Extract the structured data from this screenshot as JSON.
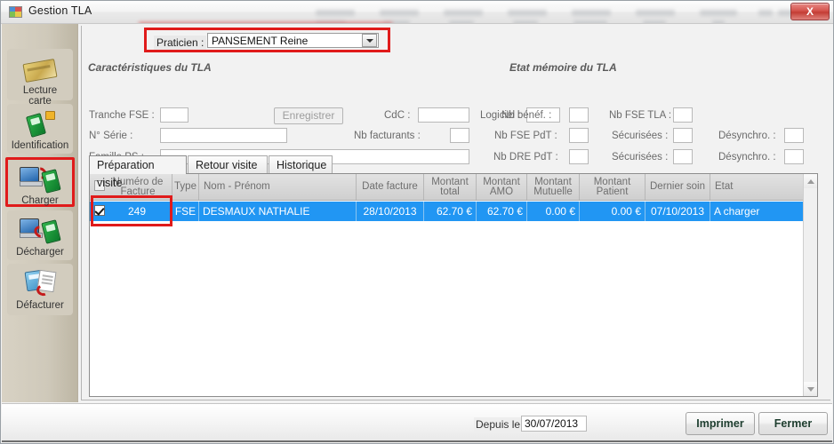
{
  "window": {
    "title": "Gestion TLA",
    "app_icon": "app-window-icon",
    "close_label": "X"
  },
  "sidebar": {
    "items": [
      {
        "label": "Lecture\ncarte",
        "label_line1": "Lecture",
        "label_line2": "carte",
        "icon": "card-reader-icon",
        "highlighted": false
      },
      {
        "label": "Identification",
        "label_line1": "Identification",
        "label_line2": "",
        "icon": "terminal-lock-icon",
        "highlighted": false
      },
      {
        "label": "Charger",
        "label_line1": "Charger",
        "label_line2": "",
        "icon": "pc-to-terminal-icon",
        "highlighted": true
      },
      {
        "label": "Décharger",
        "label_line1": "Décharger",
        "label_line2": "",
        "icon": "terminal-to-pc-icon",
        "highlighted": false
      },
      {
        "label": "Défacturer",
        "label_line1": "Défacturer",
        "label_line2": "",
        "icon": "undo-invoice-icon",
        "highlighted": false
      }
    ]
  },
  "praticien": {
    "label": "Praticien :",
    "value": "PANSEMENT Reine",
    "arrow_icon": "chevron-down-icon",
    "highlight_color": "#e01b1b"
  },
  "caracteristiques": {
    "title": "Caractéristiques du TLA",
    "tranche_fse_label": "Tranche FSE :",
    "tranche_fse_value": "",
    "enregistrer_label": "Enregistrer",
    "cdc_label": "CdC :",
    "cdc_value": "",
    "logiciel_label": "Logiciel :",
    "logiciel_value": "",
    "serie_label": "N° Série :",
    "serie_value": "",
    "nb_facturants_label": "Nb facturants :",
    "nb_facturants_value": "",
    "famille_ps_label": "Famille PS :",
    "famille_ps_value": ""
  },
  "etat_memoire": {
    "title": "Etat mémoire du TLA",
    "nb_benef_label": "Nb bénéf. :",
    "nb_benef_value": "",
    "nb_fse_tla_label": "Nb FSE TLA :",
    "nb_fse_tla_value": "",
    "nb_fse_pdt_label": "Nb FSE PdT :",
    "nb_fse_pdt_value": "",
    "securisees1_label": "Sécurisées :",
    "securisees1_value": "",
    "desynchro1_label": "Désynchro. :",
    "desynchro1_value": "",
    "nb_dre_pdt_label": "Nb DRE PdT :",
    "nb_dre_pdt_value": "",
    "securisees2_label": "Sécurisées :",
    "securisees2_value": "",
    "desynchro2_label": "Désynchro. :",
    "desynchro2_value": ""
  },
  "tabs": [
    {
      "label": "Préparation visite",
      "active": true
    },
    {
      "label": "Retour visite",
      "active": false
    },
    {
      "label": "Historique",
      "active": false
    }
  ],
  "table": {
    "select_all_checkbox": "unchecked",
    "columns": [
      {
        "label": "Numéro de\nFacture",
        "line1": "Numéro de",
        "line2": "Facture"
      },
      {
        "label": "Type",
        "line1": "Type",
        "line2": ""
      },
      {
        "label": "Nom - Prénom",
        "line1": "Nom - Prénom",
        "line2": ""
      },
      {
        "label": "Date facture",
        "line1": "Date facture",
        "line2": ""
      },
      {
        "label": "Montant\ntotal",
        "line1": "Montant",
        "line2": "total"
      },
      {
        "label": "Montant\nAMO",
        "line1": "Montant",
        "line2": "AMO"
      },
      {
        "label": "Montant\nMutuelle",
        "line1": "Montant",
        "line2": "Mutuelle"
      },
      {
        "label": "Montant\nPatient",
        "line1": "Montant",
        "line2": "Patient"
      },
      {
        "label": "Dernier soin",
        "line1": "Dernier soin",
        "line2": ""
      },
      {
        "label": "Etat",
        "line1": "Etat",
        "line2": ""
      }
    ],
    "rows": [
      {
        "checked": true,
        "numero_facture": "249",
        "type": "FSE",
        "nom_prenom": "DESMAUX NATHALIE",
        "date_facture": "28/10/2013",
        "montant_total": "62.70 €",
        "montant_amo": "62.70 €",
        "montant_mutuelle": "0.00 €",
        "montant_patient": "0.00 €",
        "dernier_soin": "07/10/2013",
        "etat": "A charger",
        "selected": true
      }
    ],
    "selection_color": "#2196f3",
    "scrollbar": {
      "up_icon": "triangle-up-icon",
      "down_icon": "triangle-down-icon"
    }
  },
  "footer": {
    "depuis_label": "Depuis le :",
    "depuis_value": "30/07/2013",
    "imprimer_label": "Imprimer",
    "fermer_label": "Fermer"
  }
}
